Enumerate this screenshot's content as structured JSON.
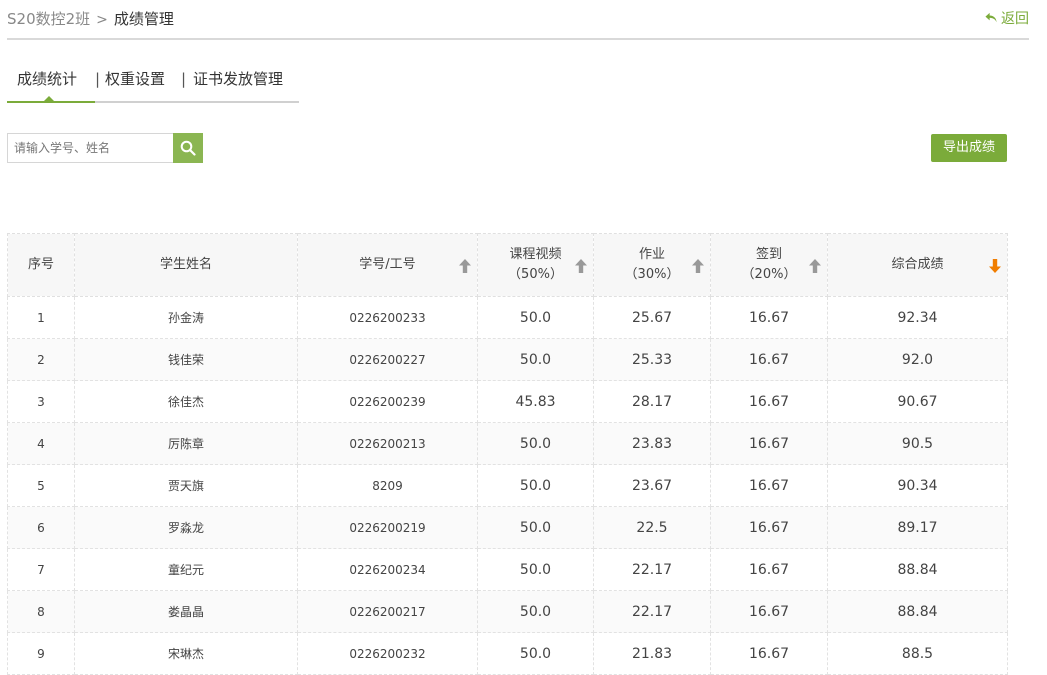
{
  "breadcrumb": {
    "class_name": "S20数控2班",
    "separator": ">",
    "current": "成绩管理"
  },
  "back": {
    "label": "返回",
    "icon": "back-arrow-icon"
  },
  "tabs": [
    {
      "label": "成绩统计",
      "active": true
    },
    {
      "label": "权重设置"
    },
    {
      "label": "证书发放管理"
    }
  ],
  "tab_separator": "|",
  "search": {
    "placeholder": "请输入学号、姓名",
    "value": "",
    "icon": "search-icon"
  },
  "export_label": "导出成绩",
  "colors": {
    "accent": "#7bab3a",
    "sort_active": "#f07d00",
    "sort_inactive": "#999999"
  },
  "table": {
    "headers": {
      "index": "序号",
      "name": "学生姓名",
      "student_id": "学号/工号",
      "video": "课程视频",
      "video_weight": "（50%）",
      "homework": "作业",
      "homework_weight": "（30%）",
      "checkin": "签到",
      "checkin_weight": "（20%）",
      "total": "综合成绩"
    },
    "rows": [
      {
        "index": "1",
        "name": "孙金涛",
        "student_id": "0226200233",
        "video": "50.0",
        "homework": "25.67",
        "checkin": "16.67",
        "total": "92.34"
      },
      {
        "index": "2",
        "name": "钱佳荣",
        "student_id": "0226200227",
        "video": "50.0",
        "homework": "25.33",
        "checkin": "16.67",
        "total": "92.0"
      },
      {
        "index": "3",
        "name": "徐佳杰",
        "student_id": "0226200239",
        "video": "45.83",
        "homework": "28.17",
        "checkin": "16.67",
        "total": "90.67"
      },
      {
        "index": "4",
        "name": "厉陈章",
        "student_id": "0226200213",
        "video": "50.0",
        "homework": "23.83",
        "checkin": "16.67",
        "total": "90.5"
      },
      {
        "index": "5",
        "name": "贾天旗",
        "student_id": "8209",
        "video": "50.0",
        "homework": "23.67",
        "checkin": "16.67",
        "total": "90.34"
      },
      {
        "index": "6",
        "name": "罗淼龙",
        "student_id": "0226200219",
        "video": "50.0",
        "homework": "22.5",
        "checkin": "16.67",
        "total": "89.17"
      },
      {
        "index": "7",
        "name": "童纪元",
        "student_id": "0226200234",
        "video": "50.0",
        "homework": "22.17",
        "checkin": "16.67",
        "total": "88.84"
      },
      {
        "index": "8",
        "name": "娄晶晶",
        "student_id": "0226200217",
        "video": "50.0",
        "homework": "22.17",
        "checkin": "16.67",
        "total": "88.84"
      },
      {
        "index": "9",
        "name": "宋琳杰",
        "student_id": "0226200232",
        "video": "50.0",
        "homework": "21.83",
        "checkin": "16.67",
        "total": "88.5"
      }
    ]
  }
}
